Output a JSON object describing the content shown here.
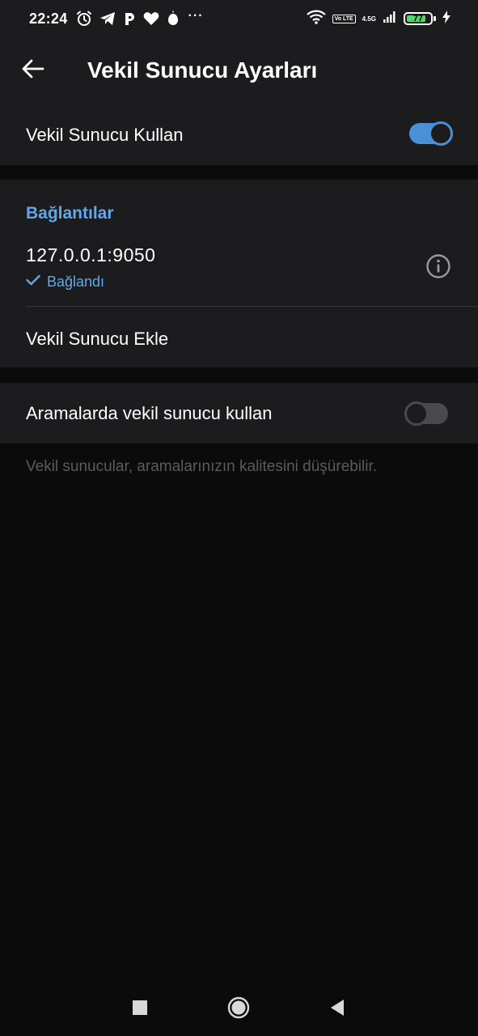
{
  "status_bar": {
    "time": "22:24",
    "left_icons": [
      "alarm-icon",
      "telegram-icon",
      "p-icon",
      "heart-icon",
      "drop-icon"
    ],
    "overflow": "···",
    "volte": "Vo LTE",
    "network": "4.5G",
    "battery": "77"
  },
  "app_bar": {
    "title": "Vekil Sunucu Ayarları",
    "back_icon": "arrow-left-icon"
  },
  "use_proxy": {
    "label": "Vekil Sunucu Kullan",
    "enabled": true
  },
  "connections": {
    "header": "Bağlantılar",
    "proxies": [
      {
        "address": "127.0.0.1:9050",
        "status": "Bağlandı"
      }
    ],
    "add_label": "Vekil Sunucu Ekle"
  },
  "calls": {
    "label": "Aramalarda vekil sunucu kullan",
    "enabled": false,
    "footnote": "Vekil sunucular, aramalarınızın kalitesini düşürebilir."
  },
  "colors": {
    "accent": "#4a90d6",
    "accent_text": "#62a8e8",
    "surface": "#1c1c1e",
    "background": "#0b0b0c"
  },
  "nav_bar": {
    "items": [
      "recents-icon",
      "home-icon",
      "back-triangle-icon"
    ]
  }
}
